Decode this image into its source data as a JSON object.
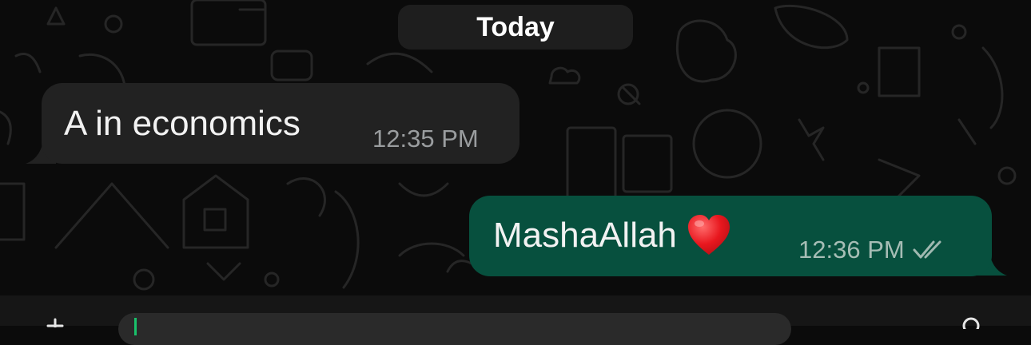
{
  "chat": {
    "date_divider": "Today",
    "messages": [
      {
        "direction": "incoming",
        "text": "A in economics",
        "time": "12:35 PM"
      },
      {
        "direction": "outgoing",
        "text": "MashaAllah",
        "emoji": "heart-emoji",
        "time": "12:36 PM",
        "status_icon": "double-check-icon"
      }
    ]
  },
  "colors": {
    "background": "#0b0b0b",
    "incoming_bubble": "#222222",
    "outgoing_bubble": "#07503e",
    "date_pill": "#1e1e1e",
    "cursor": "#19c26b"
  },
  "composer": {
    "left_icon": "plus-icon",
    "right_icon": "camera-icon"
  }
}
